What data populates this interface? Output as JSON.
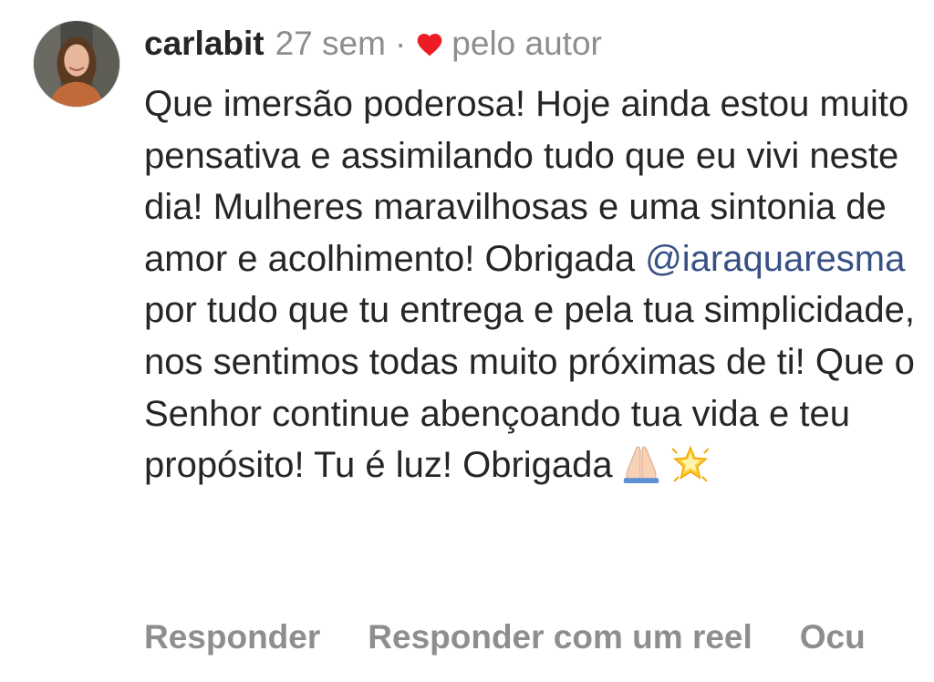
{
  "comment": {
    "username": "carlabit",
    "time": "27 sem",
    "separator": "·",
    "liked_by": "pelo autor",
    "text_before_mention": "Que imersão poderosa! Hoje ainda estou muito pensativa e assimilando tudo que eu vivi neste dia! Mulheres maravilhosas e uma sintonia de amor e acolhimento! Obrigada ",
    "mention": "@iaraquaresma",
    "text_after_mention": " por tudo que tu entrega e pela tua simplicidade, nos sentimos todas muito próximas de ti! Que o Senhor continue abençoando tua vida e teu propósito! Tu é luz! Obrigada",
    "emojis": [
      "folded-hands-icon",
      "glowing-star-icon"
    ]
  },
  "actions": {
    "reply": "Responder",
    "reply_reel": "Responder com um reel",
    "hide": "Ocu"
  },
  "colors": {
    "text": "#262626",
    "muted": "#8e8e8e",
    "heart": "#ed1c24",
    "mention": "#385185"
  }
}
